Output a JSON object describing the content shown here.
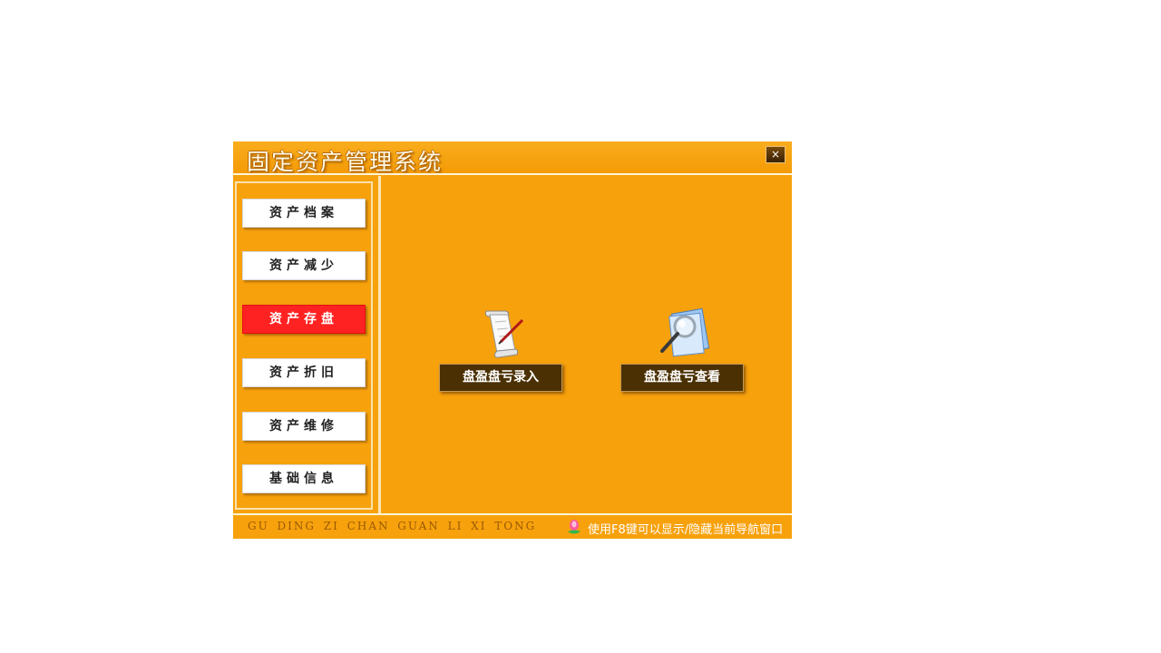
{
  "window": {
    "title": "固定资产管理系统",
    "close_label": "×"
  },
  "sidebar": {
    "items": [
      {
        "label": "资产档案",
        "active": false
      },
      {
        "label": "资产减少",
        "active": false
      },
      {
        "label": "资产存盘",
        "active": true
      },
      {
        "label": "资产折旧",
        "active": false
      },
      {
        "label": "资产维修",
        "active": false
      },
      {
        "label": "基础信息",
        "active": false
      }
    ]
  },
  "main": {
    "actions": [
      {
        "label": "盘盈盘亏录入",
        "icon": "scroll-pen-icon"
      },
      {
        "label": "盘盈盘亏查看",
        "icon": "magnifier-document-icon"
      }
    ]
  },
  "footer": {
    "pinyin": "GU DING ZI CHAN GUAN LI XI TONG",
    "hint": "使用F8键可以显示/隐藏当前导航窗口",
    "hint_icon": "lotus-icon"
  },
  "colors": {
    "background": "#f7a10c",
    "active_item": "#ff2222",
    "action_button": "#4b3003"
  }
}
